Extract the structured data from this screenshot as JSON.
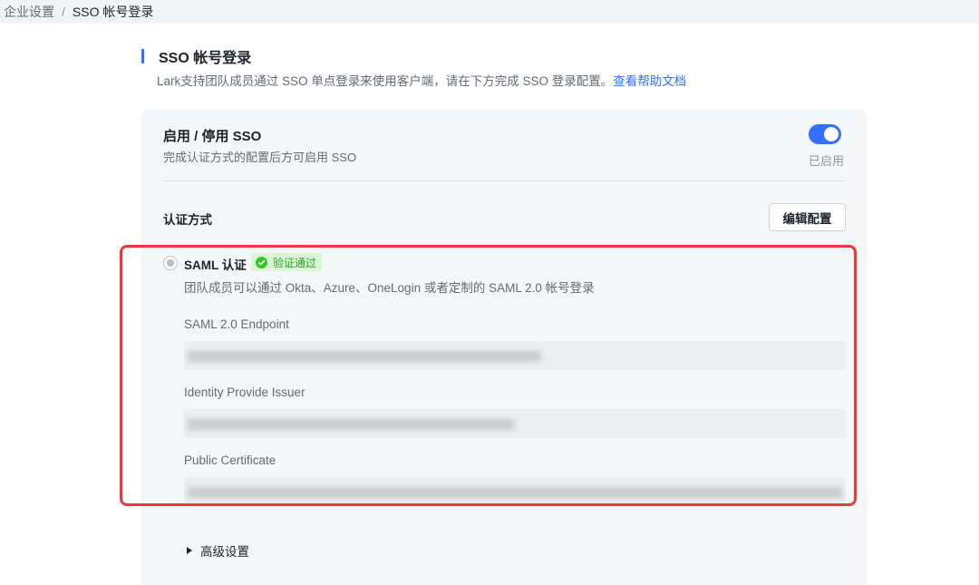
{
  "breadcrumb": {
    "parent": "企业设置",
    "separator": "/",
    "current": "SSO 帐号登录"
  },
  "header": {
    "title": "SSO 帐号登录",
    "description": "Lark支持团队成员通过 SSO 单点登录来使用客户端，请在下方完成 SSO 登录配置。",
    "help_link": "查看帮助文档"
  },
  "toggle": {
    "title": "启用 / 停用 SSO",
    "description": "完成认证方式的配置后方可启用 SSO",
    "enabled": true,
    "status": "已启用"
  },
  "auth": {
    "section_label": "认证方式",
    "edit_button": "编辑配置",
    "saml": {
      "title": "SAML 认证",
      "badge": "验证通过",
      "description": "团队成员可以通过 Okta、Azure、OneLogin 或者定制的 SAML 2.0 帐号登录",
      "fields": [
        {
          "label": "SAML 2.0 Endpoint"
        },
        {
          "label": "Identity Provide Issuer"
        },
        {
          "label": "Public Certificate"
        }
      ]
    }
  },
  "advanced": {
    "label": "高级设置"
  },
  "colors": {
    "accent": "#3370ff",
    "highlight": "#e83a3a",
    "success": "#34c724"
  }
}
